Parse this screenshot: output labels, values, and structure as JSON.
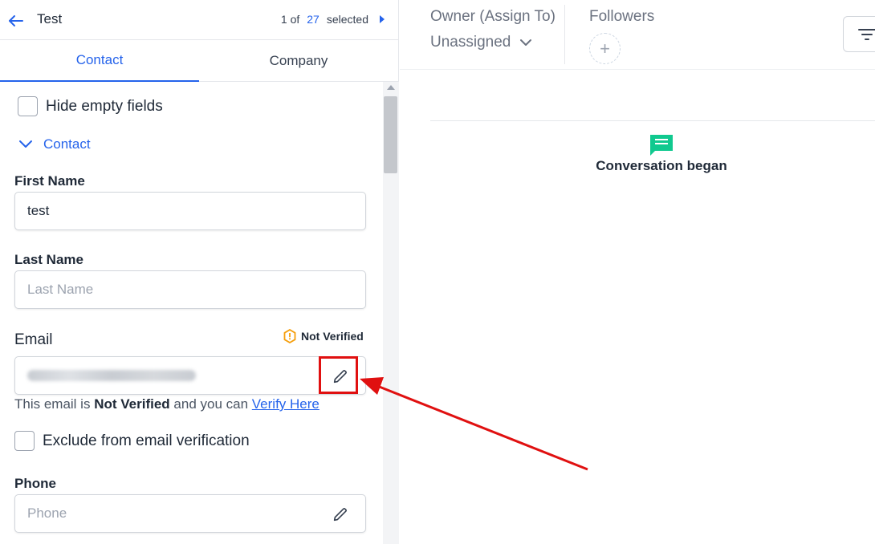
{
  "header": {
    "title": "Test",
    "pager_prefix": "1 of",
    "pager_count": "27",
    "pager_suffix": "selected"
  },
  "tabs": [
    {
      "label": "Contact",
      "active": true
    },
    {
      "label": "Company",
      "active": false
    }
  ],
  "hide_empty": {
    "label": "Hide empty fields"
  },
  "section": {
    "label": "Contact"
  },
  "fields": {
    "first_name": {
      "label": "First Name",
      "value": "test"
    },
    "last_name": {
      "label": "Last Name",
      "placeholder": "Last Name"
    },
    "email": {
      "label": "Email",
      "status": "Not Verified"
    },
    "phone": {
      "label": "Phone",
      "placeholder": "Phone"
    }
  },
  "email_helper": {
    "prefix": "This email is",
    "bold": "Not Verified",
    "middle": "and you can",
    "link": "Verify Here"
  },
  "exclude_verification": {
    "label": "Exclude from email verification"
  },
  "right": {
    "owner_label": "Owner (Assign To)",
    "owner_value": "Unassigned",
    "followers_label": "Followers",
    "add_follower_symbol": "+",
    "timeline_event": "Conversation began"
  },
  "colors": {
    "accent": "#2563eb",
    "warning": "#f59e0b",
    "conversation": "#10c98f",
    "annotation": "#e01010"
  },
  "icons": [
    "back-arrow-icon",
    "next-caret-icon",
    "chevron-down-icon",
    "warning-shield-icon",
    "pencil-icon",
    "filter-icon",
    "chat-bubble-icon",
    "plus-icon"
  ]
}
